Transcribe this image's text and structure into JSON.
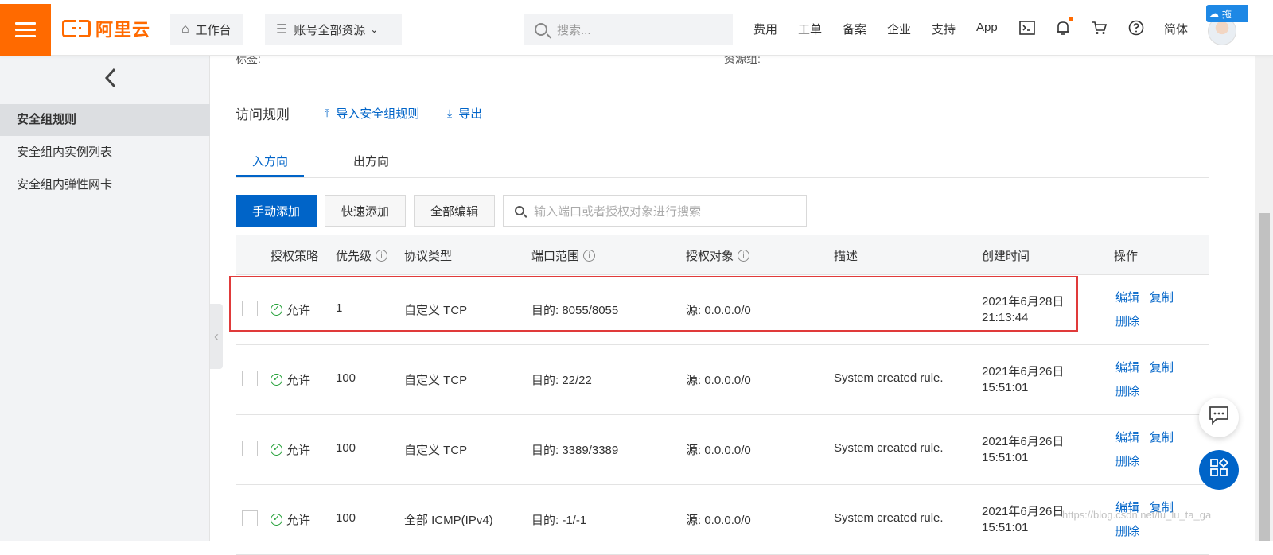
{
  "topbar": {
    "logo_text": "阿里云",
    "workbench": "工作台",
    "resources": "账号全部资源",
    "search_placeholder": "搜索...",
    "nav": [
      "费用",
      "工单",
      "备案",
      "企业",
      "支持",
      "App"
    ],
    "lang": "简体",
    "float_badge": "拖"
  },
  "sidebar": {
    "items": [
      {
        "label": "安全组规则",
        "active": true
      },
      {
        "label": "安全组内实例列表",
        "active": false
      },
      {
        "label": "安全组内弹性网卡",
        "active": false
      }
    ]
  },
  "main": {
    "cut_labels": [
      "标签:",
      "资源组:"
    ],
    "section_title": "访问规则",
    "import_label": "导入安全组规则",
    "export_label": "导出",
    "tabs": [
      "入方向",
      "出方向"
    ],
    "buttons": {
      "manual_add": "手动添加",
      "quick_add": "快速添加",
      "edit_all": "全部编辑"
    },
    "filter_placeholder": "输入端口或者授权对象进行搜索",
    "columns": [
      "授权策略",
      "优先级",
      "协议类型",
      "端口范围",
      "授权对象",
      "描述",
      "创建时间",
      "操作"
    ],
    "rows": [
      {
        "policy": "允许",
        "priority": "1",
        "protocol": "自定义 TCP",
        "port": "目的: 8055/8055",
        "source": "源: 0.0.0.0/0",
        "desc": "",
        "date": "2021年6月28日",
        "time": "21:13:44"
      },
      {
        "policy": "允许",
        "priority": "100",
        "protocol": "自定义 TCP",
        "port": "目的: 22/22",
        "source": "源: 0.0.0.0/0",
        "desc": "System created rule.",
        "date": "2021年6月26日",
        "time": "15:51:01"
      },
      {
        "policy": "允许",
        "priority": "100",
        "protocol": "自定义 TCP",
        "port": "目的: 3389/3389",
        "source": "源: 0.0.0.0/0",
        "desc": "System created rule.",
        "date": "2021年6月26日",
        "time": "15:51:01"
      },
      {
        "policy": "允许",
        "priority": "100",
        "protocol": "全部 ICMP(IPv4)",
        "port": "目的: -1/-1",
        "source": "源: 0.0.0.0/0",
        "desc": "System created rule.",
        "date": "2021年6月26日",
        "time": "15:51:01"
      }
    ],
    "ops": {
      "edit": "编辑",
      "copy": "复制",
      "delete": "删除"
    }
  },
  "watermark": "https://blog.csdn.net/lu_lu_ta_ga",
  "colors": {
    "brand": "#ff6a00",
    "primary": "#0064c8",
    "highlight": "#e03a3a",
    "success": "#1e9e33"
  }
}
